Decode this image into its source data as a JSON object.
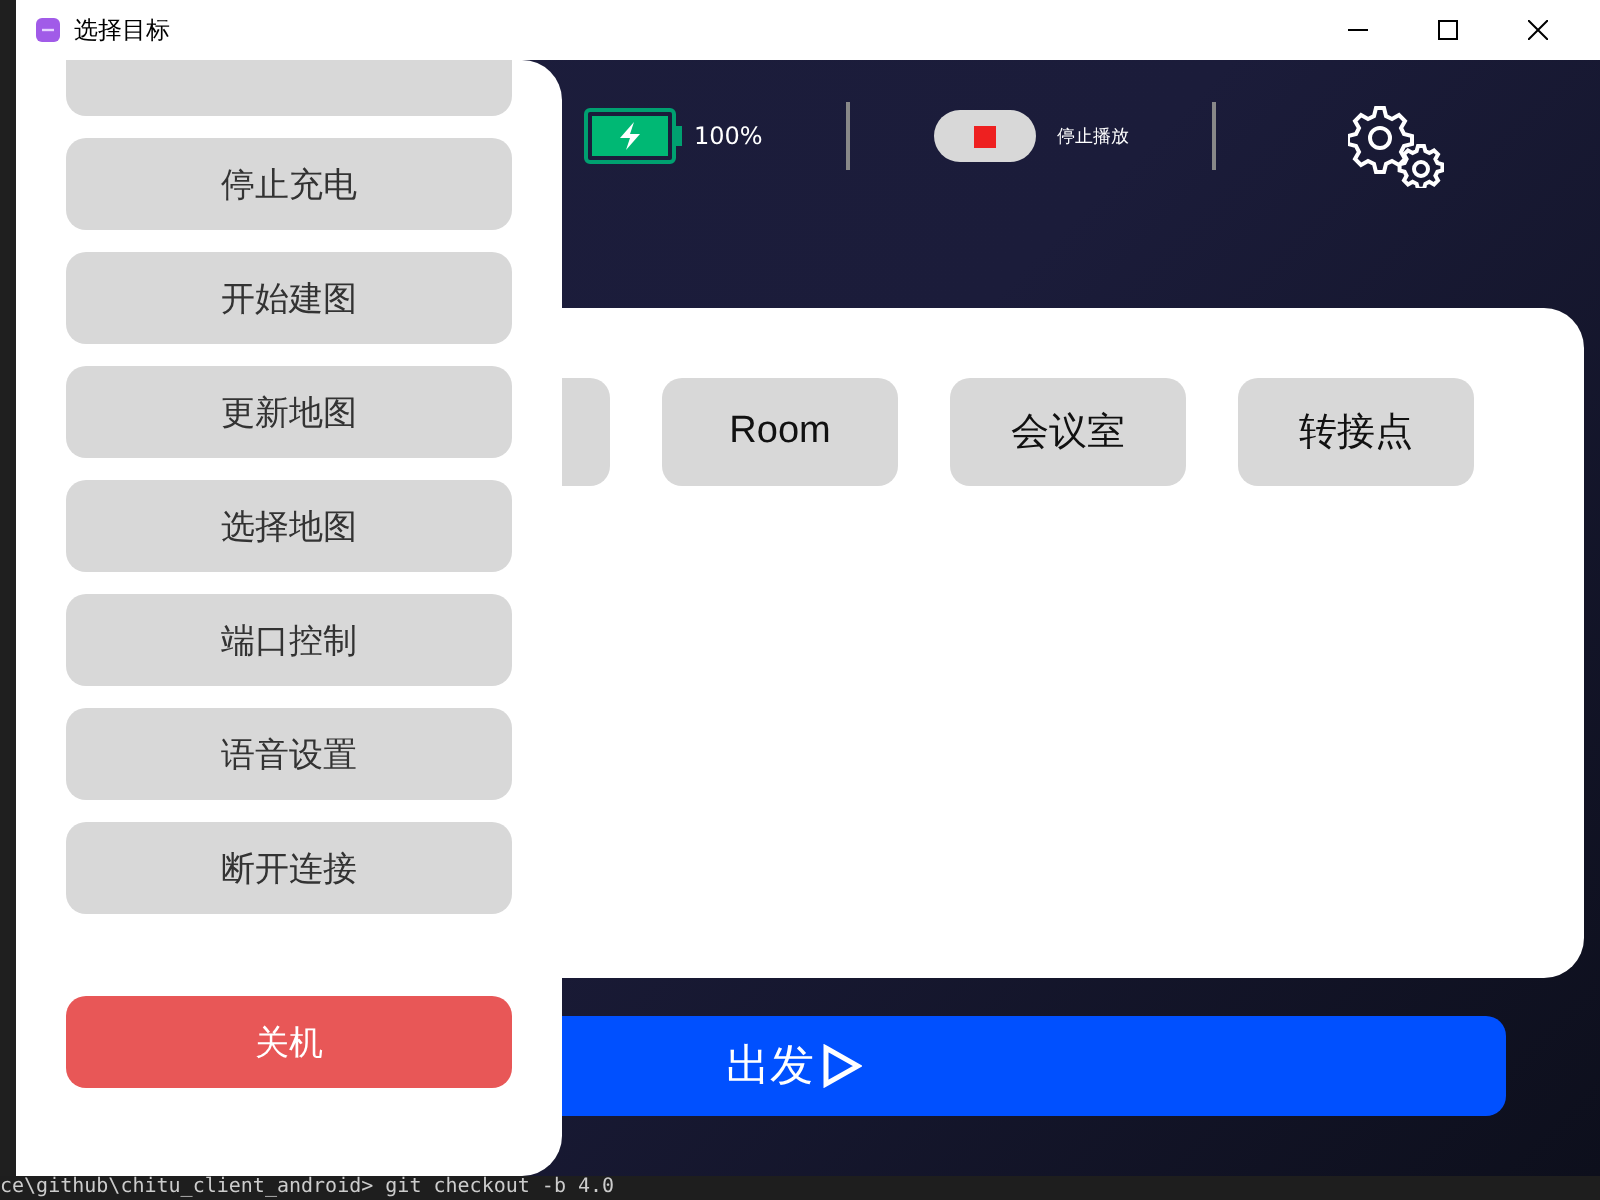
{
  "window": {
    "title": "选择目标"
  },
  "status": {
    "battery": "100%",
    "stop_button": "停止播放"
  },
  "drawer": {
    "items": [
      {
        "label": "停止充电",
        "kind": "normal"
      },
      {
        "label": "开始建图",
        "kind": "normal"
      },
      {
        "label": "更新地图",
        "kind": "normal"
      },
      {
        "label": "选择地图",
        "kind": "normal"
      },
      {
        "label": "端口控制",
        "kind": "normal"
      },
      {
        "label": "语音设置",
        "kind": "normal"
      },
      {
        "label": "断开连接",
        "kind": "normal"
      },
      {
        "label": "关机",
        "kind": "danger"
      }
    ]
  },
  "destinations": [
    {
      "label": "Room"
    },
    {
      "label": "会议室"
    },
    {
      "label": "转接点"
    }
  ],
  "go_button": {
    "label": "出发"
  },
  "terminal": {
    "line": "ce\\github\\chitu_client_android> git checkout -b 4.0"
  }
}
